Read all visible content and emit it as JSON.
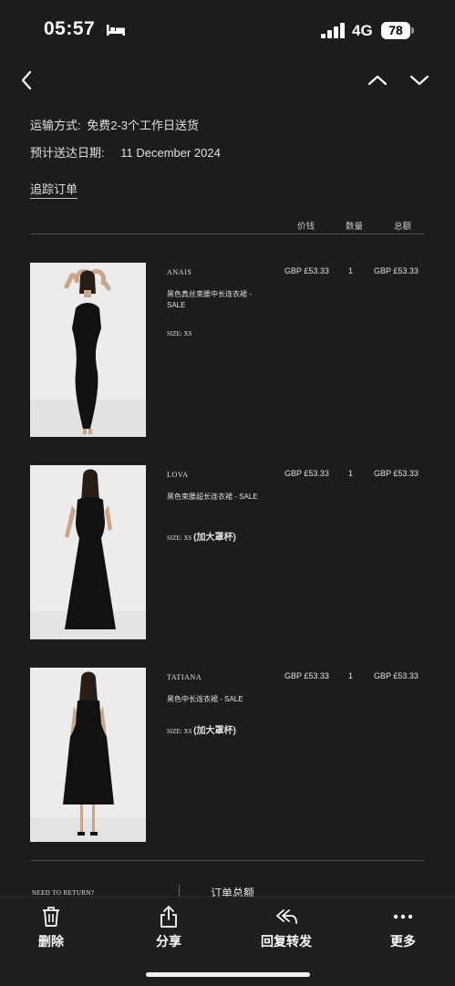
{
  "status_bar": {
    "time": "05:57",
    "network": "4G",
    "battery": "78",
    "battery_level": 0.78,
    "sleep_icon": "bed-icon"
  },
  "nav": {
    "back_icon": "chevron-left-icon",
    "prev_icon": "chevron-up-icon",
    "next_icon": "chevron-down-icon"
  },
  "shipping": {
    "method_label": "运输方式:",
    "method_value": "免费2-3个工作日送货",
    "date_label": "预计送达日期:",
    "date_value": "11 December 2024",
    "track_link": "追踪订单"
  },
  "columns": {
    "price": "价钱",
    "qty": "数量",
    "total": "总额"
  },
  "products": [
    {
      "name": "ANAIS",
      "desc": "黑色真丝束腰中长连衣裙 - SALE",
      "size_label": "SIZE: XS",
      "size_note": "",
      "price": "GBP £53.33",
      "qty": "1",
      "total": "GBP £53.33"
    },
    {
      "name": "LOVA",
      "desc": "黑色束腰超长连衣裙 - SALE",
      "size_label": "SIZE: XS",
      "size_note": "(加大罩杯)",
      "price": "GBP £53.33",
      "qty": "1",
      "total": "GBP £53.33"
    },
    {
      "name": "TATIANA",
      "desc": "黑色中长连衣裙 - SALE",
      "size_label": "SIZE: XS",
      "size_note": "(加大罩杯)",
      "price": "GBP £53.33",
      "qty": "1",
      "total": "GBP £53.33"
    }
  ],
  "footer": {
    "need_return": "NEED TO RETURN?",
    "order_total": "订单总额"
  },
  "toolbar": {
    "delete": {
      "label": "删除",
      "icon": "trash-icon"
    },
    "share": {
      "label": "分享",
      "icon": "share-icon"
    },
    "reply": {
      "label": "回复转发",
      "icon": "reply-all-icon"
    },
    "more": {
      "label": "更多",
      "icon": "more-icon"
    }
  },
  "colors": {
    "background": "#1c1c1e",
    "text": "#e6e6e6",
    "image_bg": "#ececec",
    "dress": "#111111"
  }
}
